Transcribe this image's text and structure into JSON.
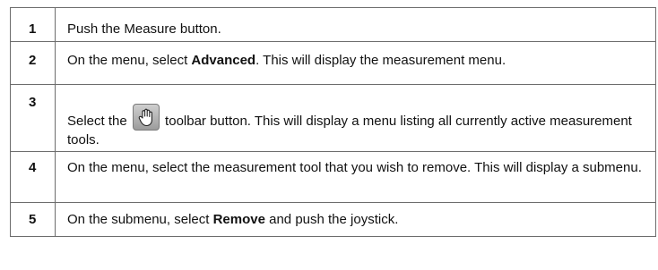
{
  "steps": [
    {
      "num": "1",
      "parts": [
        {
          "t": "Push the Measure button."
        }
      ]
    },
    {
      "num": "2",
      "a": "On the menu, select ",
      "b": "Advanced",
      "c": ". This will display the measurement menu."
    },
    {
      "num": "3",
      "a": "Select the ",
      "icon": "hand-pointer-icon",
      "c": " toolbar button. This will display a menu listing all currently active measurement tools."
    },
    {
      "num": "4",
      "a": "On the menu, select the measurement tool that you wish to remove. This will display a submenu."
    },
    {
      "num": "5",
      "a": "On the submenu, select ",
      "b": "Remove",
      "c": " and push the joystick."
    }
  ]
}
